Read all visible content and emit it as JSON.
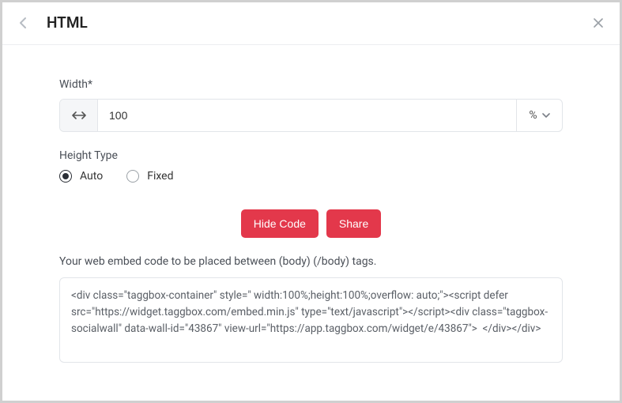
{
  "header": {
    "title": "HTML"
  },
  "width_section": {
    "label": "Width*",
    "value": "100",
    "unit": "%"
  },
  "height_type": {
    "label": "Height Type",
    "options": [
      {
        "label": "Auto",
        "selected": true
      },
      {
        "label": "Fixed",
        "selected": false
      }
    ]
  },
  "buttons": {
    "hide_code": "Hide Code",
    "share": "Share"
  },
  "embed": {
    "description": "Your web embed code to be placed between (body) (/body) tags.",
    "code": "<div class=\"taggbox-container\" style=\" width:100%;height:100%;overflow: auto;\"><script defer src=\"https://widget.taggbox.com/embed.min.js\" type=\"text/javascript\"></script><div class=\"taggbox-socialwall\" data-wall-id=\"43867\" view-url=\"https://app.taggbox.com/widget/e/43867\">  </div></div>"
  }
}
